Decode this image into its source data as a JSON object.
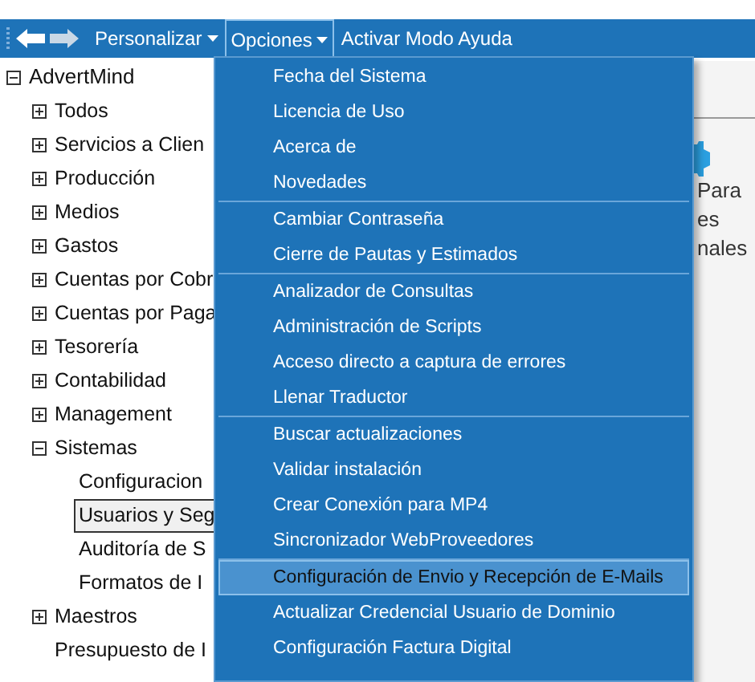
{
  "toolbar": {
    "items": [
      {
        "label": "Personalizar",
        "selected": false,
        "kind": "menu"
      },
      {
        "label": "Opciones",
        "selected": true,
        "kind": "menu"
      },
      {
        "label": "Activar Modo Ayuda",
        "selected": false,
        "kind": "action"
      }
    ]
  },
  "tree": {
    "label": "AdvertMind",
    "expanded": true,
    "children": [
      {
        "label": "Todos",
        "expanded": false,
        "kind": "folder"
      },
      {
        "label": "Servicios a Clien",
        "expanded": false,
        "kind": "folder"
      },
      {
        "label": "Producción",
        "expanded": false,
        "kind": "folder"
      },
      {
        "label": "Medios",
        "expanded": false,
        "kind": "folder"
      },
      {
        "label": "Gastos",
        "expanded": false,
        "kind": "folder"
      },
      {
        "label": "Cuentas por Cobr",
        "expanded": false,
        "kind": "folder"
      },
      {
        "label": "Cuentas por Paga",
        "expanded": false,
        "kind": "folder"
      },
      {
        "label": "Tesorería",
        "expanded": false,
        "kind": "folder"
      },
      {
        "label": "Contabilidad",
        "expanded": false,
        "kind": "folder"
      },
      {
        "label": "Management",
        "expanded": false,
        "kind": "folder"
      },
      {
        "label": "Sistemas",
        "expanded": true,
        "kind": "folder",
        "children": [
          {
            "label": "Configuracion",
            "selected": false
          },
          {
            "label": "Usuarios y Seg",
            "selected": true
          },
          {
            "label": "Auditoría de S",
            "selected": false
          },
          {
            "label": "Formatos de I",
            "selected": false
          }
        ]
      },
      {
        "label": "Maestros",
        "expanded": false,
        "kind": "folder"
      },
      {
        "label": "Presupuesto de I",
        "kind": "leaf"
      }
    ]
  },
  "menu": {
    "groups": [
      [
        {
          "label": "Fecha del Sistema",
          "selected": false
        },
        {
          "label": "Licencia de Uso",
          "selected": false
        },
        {
          "label": "Acerca de",
          "selected": false
        },
        {
          "label": "Novedades",
          "selected": false
        }
      ],
      [
        {
          "label": "Cambiar Contraseña",
          "selected": false
        },
        {
          "label": "Cierre de Pautas y Estimados",
          "selected": false
        }
      ],
      [
        {
          "label": "Analizador de Consultas",
          "selected": false
        },
        {
          "label": "Administración de Scripts",
          "selected": false
        },
        {
          "label": "Acceso directo a captura de errores",
          "selected": false
        },
        {
          "label": "Llenar Traductor",
          "selected": false
        }
      ],
      [
        {
          "label": "Buscar actualizaciones",
          "selected": false
        },
        {
          "label": "Validar instalación",
          "selected": false
        },
        {
          "label": "Crear Conexión para MP4",
          "selected": false
        },
        {
          "label": "Sincronizador WebProveedores",
          "selected": false
        }
      ],
      [
        {
          "label": "Configuración de Envio y Recepción de E-Mails",
          "selected": true
        },
        {
          "label": "Actualizar Credencial Usuario de Dominio",
          "selected": false
        },
        {
          "label": "Configuración Factura Digital",
          "selected": false
        }
      ]
    ]
  },
  "side_panel": {
    "lines": [
      "Para",
      "es",
      "nales"
    ]
  }
}
